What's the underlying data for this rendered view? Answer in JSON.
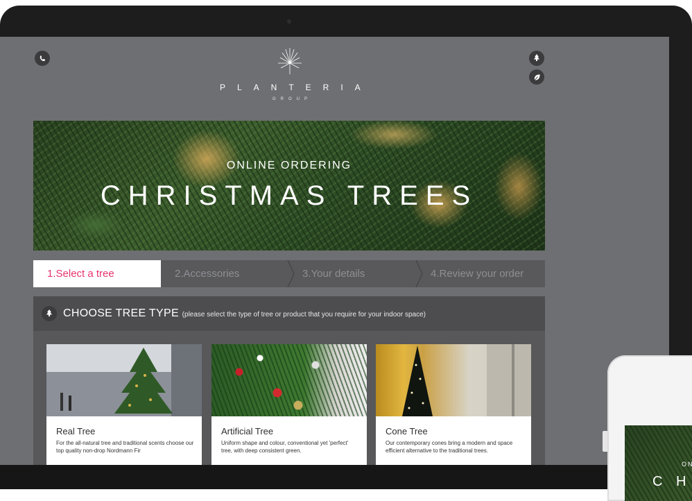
{
  "site": {
    "brand": "PLANTERIA",
    "brand_sub": "GROUP",
    "icons": {
      "phone": "phone-icon",
      "tree": "tree-icon",
      "leaf": "leaf-icon",
      "logo": "palm-logo-icon"
    }
  },
  "hero": {
    "subtitle": "ONLINE ORDERING",
    "title": "CHRISTMAS TREES"
  },
  "steps": [
    {
      "label": "1.Select a tree",
      "active": true
    },
    {
      "label": "2.Accessories",
      "active": false
    },
    {
      "label": "3.Your details",
      "active": false
    },
    {
      "label": "4.Review your order",
      "active": false
    }
  ],
  "panel": {
    "title": "CHOOSE TREE TYPE",
    "note": "(please select the type of tree or product that you require for your indoor space)"
  },
  "cards": [
    {
      "title": "Real Tree",
      "desc": "For the all-natural tree and traditional scents choose our top quality non-drop Nordmann Fir"
    },
    {
      "title": "Artificial Tree",
      "desc": "Uniform shape and colour, conventional yet 'perfect' tree, with deep consistent green."
    },
    {
      "title": "Cone Tree",
      "desc": "Our contemporary cones bring a modern and space efficient alternative to the traditional trees."
    }
  ],
  "phone": {
    "subtitle": "ON",
    "title": "C H"
  },
  "colors": {
    "accent": "#e8336d",
    "screen_bg": "#6e6f72",
    "panel_bg": "#58585b"
  }
}
